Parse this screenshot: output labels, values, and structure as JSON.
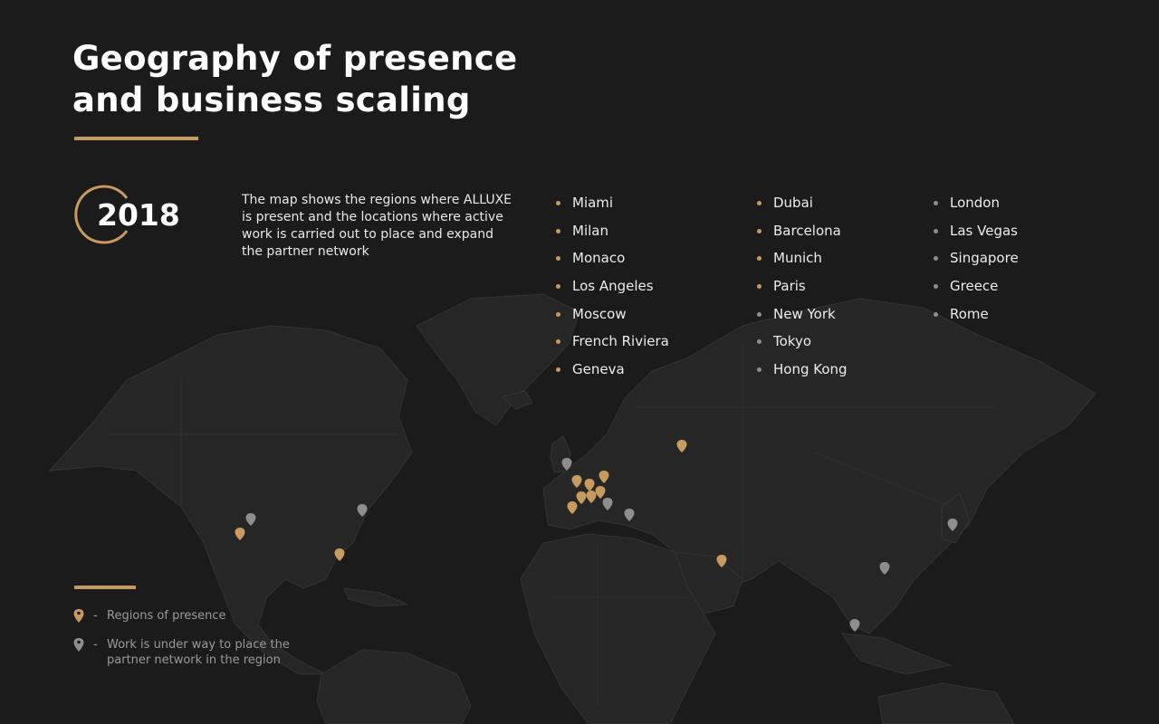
{
  "title_line1": "Geography of presence",
  "title_line2": "and business scaling",
  "year": "2018",
  "description": "The map shows the regions where ALLUXE is present and the locations where active work is carried out to place and expand the partner network",
  "colors": {
    "background": "#1b1b1b",
    "land": "#262626",
    "accent": "#c79a5e",
    "planned": "#8e8e8e"
  },
  "cities": {
    "column1": [
      {
        "name": "Miami",
        "status": "presence"
      },
      {
        "name": "Milan",
        "status": "presence"
      },
      {
        "name": "Monaco",
        "status": "presence"
      },
      {
        "name": "Los Angeles",
        "status": "presence"
      },
      {
        "name": "Moscow",
        "status": "presence"
      },
      {
        "name": "French Riviera",
        "status": "presence"
      },
      {
        "name": "Geneva",
        "status": "presence"
      }
    ],
    "column2": [
      {
        "name": "Dubai",
        "status": "presence"
      },
      {
        "name": "Barcelona",
        "status": "presence"
      },
      {
        "name": "Munich",
        "status": "presence"
      },
      {
        "name": "Paris",
        "status": "presence"
      },
      {
        "name": "New York",
        "status": "planned"
      },
      {
        "name": "Tokyo",
        "status": "planned"
      },
      {
        "name": "Hong Kong",
        "status": "planned"
      }
    ],
    "column3": [
      {
        "name": "London",
        "status": "planned"
      },
      {
        "name": "Las Vegas",
        "status": "planned"
      },
      {
        "name": "Singapore",
        "status": "planned"
      },
      {
        "name": "Greece",
        "status": "planned"
      },
      {
        "name": "Rome",
        "status": "planned"
      }
    ]
  },
  "legend": {
    "presence_label": "Regions of presence",
    "planned_label": "Work is under way to place the partner network in the region",
    "dash": "-"
  },
  "icons": {
    "presence": "map-pin-icon",
    "planned": "map-pin-icon",
    "year_ring": "ring-arc-icon"
  }
}
